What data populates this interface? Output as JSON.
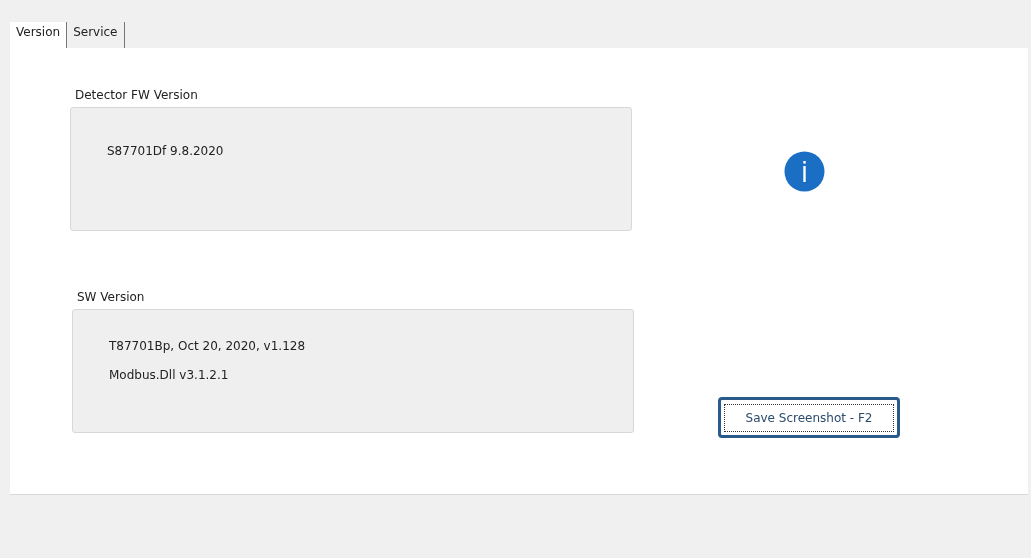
{
  "tabs": [
    {
      "label": "Version",
      "selected": true
    },
    {
      "label": "Service",
      "selected": false
    }
  ],
  "groups": [
    {
      "title": "Detector FW Version",
      "lines": [
        "S87701Df 9.8.2020"
      ]
    },
    {
      "title": "SW Version",
      "lines": [
        "T87701Bp, Oct 20, 2020, v1.128",
        "Modbus.Dll v3.1.2.1"
      ]
    }
  ],
  "save_button": {
    "label": "Save Screenshot - F2"
  }
}
